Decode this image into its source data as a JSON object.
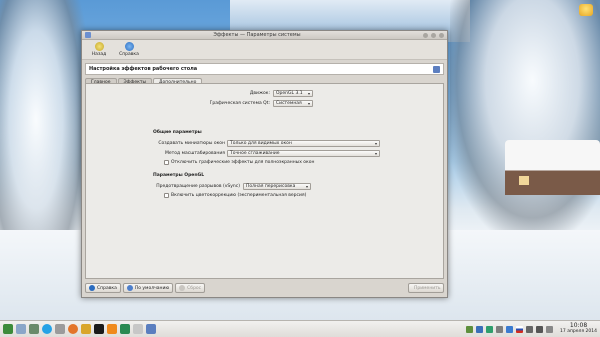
{
  "desktop": {
    "trash_label": ""
  },
  "window": {
    "title": "Эффекты — Параметры системы",
    "toolbar": {
      "back_label": "Назад",
      "help_label": "Справка"
    },
    "header": "Настройка эффектов рабочего стола",
    "tabs": [
      "Главное",
      "Эффекты",
      "Дополнительно"
    ],
    "active_tab": "Дополнительно",
    "settings": {
      "backend_label": "Движок:",
      "backend_value": "OpenGL 3.1",
      "qt_label": "Графическая система Qt:",
      "qt_value": "Системная",
      "general_heading": "Общие параметры",
      "thumbs_label": "Создавать миниатюры окон",
      "thumbs_value": "Только для видимых окон",
      "scale_label": "Метод масштабирования",
      "scale_value": "Точное сглаживание",
      "fullscreen_unredirect": "Отключить графические эффекты для полноэкранных окон",
      "opengl_heading": "Параметры OpenGL",
      "tearing_label": "Предотвращение разрывов (vSync)",
      "tearing_value": "Полная перерисовка",
      "color_correction": "Включить цветокоррекцию (экспериментальная версия)"
    },
    "buttons": {
      "help": "Справка",
      "defaults": "По умолчанию",
      "reset": "Сброс",
      "apply": "Применить"
    }
  },
  "taskbar": {
    "time": "10:08",
    "date": "17 апреля 2014",
    "colors": {
      "accent": "#2a6cc0",
      "panel": "#e8e6e3"
    }
  }
}
